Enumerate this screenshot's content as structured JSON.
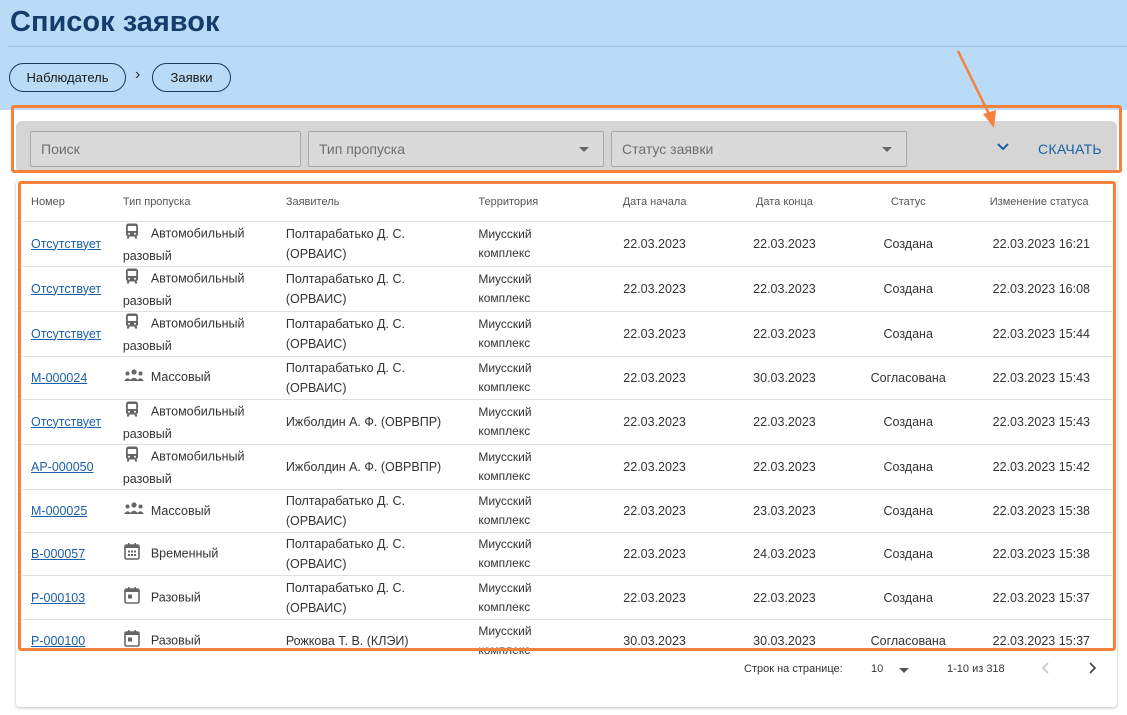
{
  "page": {
    "title": "Список заявок"
  },
  "breadcrumb": {
    "items": [
      "Наблюдатель",
      "Заявки"
    ],
    "separator": "›"
  },
  "filters": {
    "search_placeholder": "Поиск",
    "pass_type_placeholder": "Тип пропуска",
    "status_placeholder": "Статус заявки",
    "download_label": "СКАЧАТЬ"
  },
  "table": {
    "headers": [
      "Номер",
      "Тип пропуска",
      "Заявитель",
      "Территория",
      "Дата начала",
      "Дата конца",
      "Статус",
      "Изменение статуса"
    ],
    "rows": [
      {
        "num": "Отсутствует",
        "icon": "bus-icon",
        "type_line1": "Автомобильный",
        "type_line2": "разовый",
        "applicant_line1": "Полтарабатько Д. С.",
        "applicant_line2": "(ОРВАИС)",
        "terr1": "Миусский",
        "terr2": "комплекс",
        "start": "22.03.2023",
        "end": "22.03.2023",
        "status": "Создана",
        "changed": "22.03.2023 16:21"
      },
      {
        "num": "Отсутствует",
        "icon": "bus-icon",
        "type_line1": "Автомобильный",
        "type_line2": "разовый",
        "applicant_line1": "Полтарабатько Д. С.",
        "applicant_line2": "(ОРВАИС)",
        "terr1": "Миусский",
        "terr2": "комплекс",
        "start": "22.03.2023",
        "end": "22.03.2023",
        "status": "Создана",
        "changed": "22.03.2023 16:08"
      },
      {
        "num": "Отсутствует",
        "icon": "bus-icon",
        "type_line1": "Автомобильный",
        "type_line2": "разовый",
        "applicant_line1": "Полтарабатько Д. С.",
        "applicant_line2": "(ОРВАИС)",
        "terr1": "Миусский",
        "terr2": "комплекс",
        "start": "22.03.2023",
        "end": "22.03.2023",
        "status": "Создана",
        "changed": "22.03.2023 15:44"
      },
      {
        "num": "М-000024",
        "icon": "group-icon",
        "type_line1": "Массовый",
        "type_line2": "",
        "applicant_line1": "Полтарабатько Д. С.",
        "applicant_line2": "(ОРВАИС)",
        "terr1": "Миусский",
        "terr2": "комплекс",
        "start": "22.03.2023",
        "end": "30.03.2023",
        "status": "Согласована",
        "changed": "22.03.2023 15:43"
      },
      {
        "num": "Отсутствует",
        "icon": "bus-icon",
        "type_line1": "Автомобильный",
        "type_line2": "разовый",
        "applicant_line1": "Ижболдин А. Ф. (ОВРВПР)",
        "applicant_line2": "",
        "terr1": "Миусский",
        "terr2": "комплекс",
        "start": "22.03.2023",
        "end": "22.03.2023",
        "status": "Создана",
        "changed": "22.03.2023 15:43"
      },
      {
        "num": "АР-000050",
        "icon": "bus-icon",
        "type_line1": "Автомобильный",
        "type_line2": "разовый",
        "applicant_line1": "Ижболдин А. Ф. (ОВРВПР)",
        "applicant_line2": "",
        "terr1": "Миусский",
        "terr2": "комплекс",
        "start": "22.03.2023",
        "end": "22.03.2023",
        "status": "Создана",
        "changed": "22.03.2023 15:42"
      },
      {
        "num": "М-000025",
        "icon": "group-icon",
        "type_line1": "Массовый",
        "type_line2": "",
        "applicant_line1": "Полтарабатько Д. С.",
        "applicant_line2": "(ОРВАИС)",
        "terr1": "Миусский",
        "terr2": "комплекс",
        "start": "22.03.2023",
        "end": "23.03.2023",
        "status": "Создана",
        "changed": "22.03.2023 15:38"
      },
      {
        "num": "В-000057",
        "icon": "calendar-range-icon",
        "type_line1": "Временный",
        "type_line2": "",
        "applicant_line1": "Полтарабатько Д. С.",
        "applicant_line2": "(ОРВАИС)",
        "terr1": "Миусский",
        "terr2": "комплекс",
        "start": "22.03.2023",
        "end": "24.03.2023",
        "status": "Создана",
        "changed": "22.03.2023 15:38"
      },
      {
        "num": "Р-000103",
        "icon": "calendar-day-icon",
        "type_line1": "Разовый",
        "type_line2": "",
        "applicant_line1": "Полтарабатько Д. С.",
        "applicant_line2": "(ОРВАИС)",
        "terr1": "Миусский",
        "terr2": "комплекс",
        "start": "22.03.2023",
        "end": "22.03.2023",
        "status": "Создана",
        "changed": "22.03.2023 15:37"
      },
      {
        "num": "Р-000100",
        "icon": "calendar-day-icon",
        "type_line1": "Разовый",
        "type_line2": "",
        "applicant_line1": "Рожкова Т. В. (КЛЭИ)",
        "applicant_line2": "",
        "terr1": "Миусский",
        "terr2": "комплекс",
        "start": "30.03.2023",
        "end": "30.03.2023",
        "status": "Согласована",
        "changed": "22.03.2023 15:37"
      }
    ]
  },
  "pagination": {
    "rows_per_page_label": "Строк на странице:",
    "rows_per_page_value": "10",
    "range_text": "1-10 из 318"
  },
  "colors": {
    "header_band": "#b9dbf6",
    "title": "#143d6b",
    "link": "#1b5fa8",
    "highlight": "#f5813d"
  }
}
